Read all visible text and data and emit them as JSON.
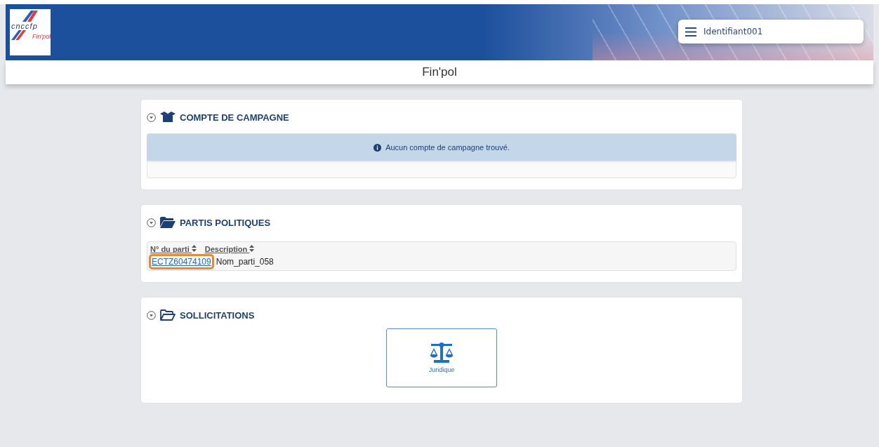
{
  "header": {
    "logo": {
      "name": "cnccfp",
      "sub": "Fin'pol"
    },
    "user_menu": {
      "label": "Identifiant001"
    }
  },
  "page_title": "Fin'pol",
  "sections": [
    {
      "kind": "alert",
      "title": "COMPTE DE CAMPAGNE",
      "expanded": true,
      "message": "Aucun compte de campagne trouvé."
    },
    {
      "kind": "table",
      "title": "PARTIS POLITIQUES",
      "expanded": true,
      "columns": [
        "N° du parti",
        "Description"
      ],
      "rows": [
        {
          "number": "ECTZ60474109",
          "description": "Nom_parti_058",
          "focused": true
        }
      ]
    },
    {
      "kind": "tiles",
      "title": "SOLLICITATIONS",
      "expanded": true,
      "tiles": [
        {
          "label": "Juridique"
        }
      ]
    }
  ]
}
